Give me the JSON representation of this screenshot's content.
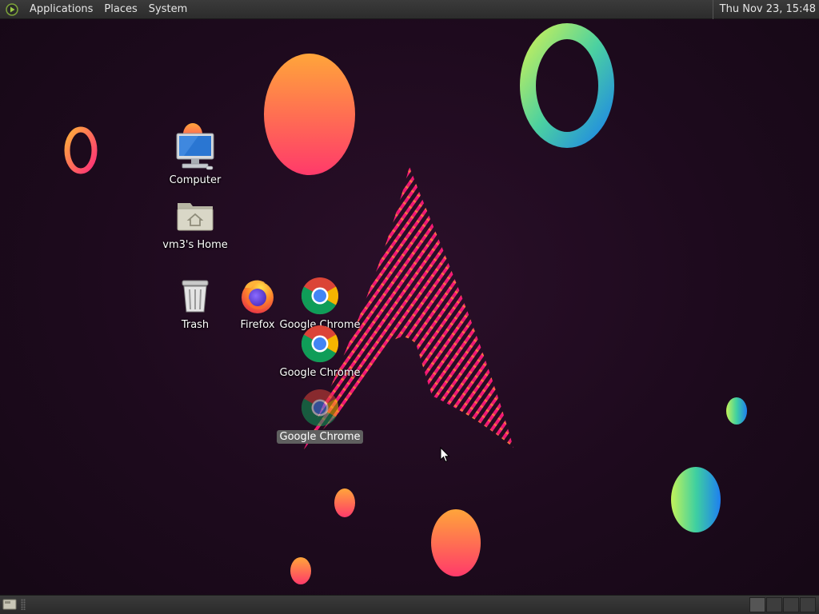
{
  "top_panel": {
    "menus": [
      "Applications",
      "Places",
      "System"
    ],
    "clock": "Thu Nov 23, 15:48"
  },
  "desktop_icons": {
    "computer": "Computer",
    "home": "vm3's Home",
    "trash": "Trash",
    "firefox": "Firefox",
    "chrome_1": "Google Chrome",
    "chrome_2": "Google Chrome",
    "chrome_3": "Google Chrome"
  },
  "bottom_panel": {
    "workspace_count": 4
  },
  "colors": {
    "background": "#1d0a1d",
    "accent_pink": "#e91e63",
    "accent_orange": "#ff9a3c",
    "accent_green": "#b6f06a",
    "accent_blue": "#2196f3"
  }
}
